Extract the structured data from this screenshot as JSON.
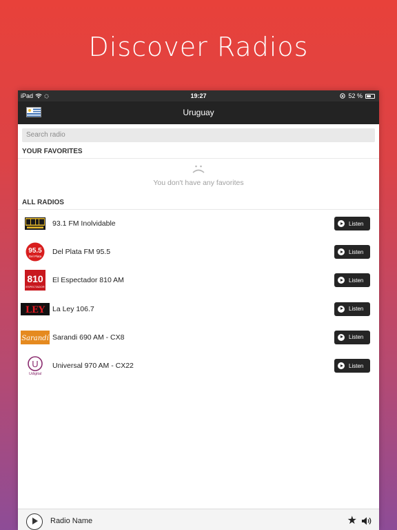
{
  "headline": "Discover Radios",
  "status_bar": {
    "device": "iPad",
    "time": "19:27",
    "battery": "52 %"
  },
  "nav": {
    "title": "Uruguay",
    "flag_icon": "uruguay-flag-icon"
  },
  "search": {
    "placeholder": "Search radio"
  },
  "favorites": {
    "header": "YOUR FAVORITES",
    "empty_text": "You don't have any favorites",
    "empty_icon": "sad-face-icon"
  },
  "all_radios": {
    "header": "ALL RADIOS",
    "listen_label": "Listen",
    "items": [
      {
        "name": "93.1 FM Inolvidable"
      },
      {
        "name": "Del Plata FM 95.5",
        "logo_text": "95.5",
        "logo_sub": "Del Plata"
      },
      {
        "name": "El Espectador 810 AM",
        "logo_text": "810",
        "logo_sub": "ESPECTADOR"
      },
      {
        "name": "La Ley 106.7",
        "logo_text": "LEY"
      },
      {
        "name": "Sarandi 690 AM - CX8",
        "logo_text": "Sarandí"
      },
      {
        "name": "Universal 970 AM - CX22",
        "logo_text": "U",
        "logo_sub": "Udigital"
      }
    ]
  },
  "player": {
    "name": "Radio Name"
  },
  "colors": {
    "gradient_top": "#e8413a",
    "gradient_bottom": "#8d4c97",
    "nav_bg": "#232323",
    "button_bg": "#252525"
  }
}
